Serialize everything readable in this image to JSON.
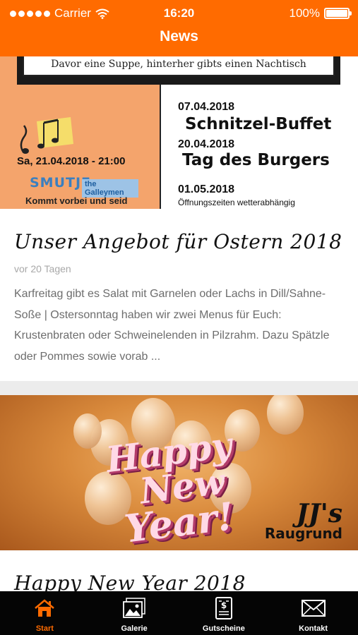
{
  "status_bar": {
    "carrier": "Carrier",
    "time": "16:20",
    "battery": "100%"
  },
  "nav": {
    "title": "News"
  },
  "posts": [
    {
      "image": {
        "banner": "Davor eine Suppe, hinterher gibts einen Nachtisch",
        "event_date": "Sa, 21.04.2018 - 21:00",
        "band": "SMUTJE",
        "band_sub": "the Galleymen",
        "band_tagline": "Kommt vorbei und seid",
        "events": [
          {
            "date": "07.04.2018",
            "name": "Schnitzel-Buffet"
          },
          {
            "date": "20.04.2018",
            "name": "Tag des Burgers"
          },
          {
            "date": "01.05.2018",
            "name": "Öffnungszeiten wetterabhängig"
          }
        ]
      },
      "title": "Unser Angebot für Ostern 2018",
      "age": "vor 20 Tagen",
      "excerpt": "Karfreitag gibt es Salat mit Garnelen oder Lachs in Dill/Sahne-Soße | Ostersonntag haben wir zwei Menus für Euch: Krustenbraten oder Schweinelenden in Pilzrahm. Dazu Spätzle oder Pommes sowie vorab ..."
    },
    {
      "image": {
        "line1": "Happy",
        "line2": "New",
        "line3": "Year!",
        "brand1": "JJ's",
        "brand2": "Raugrund"
      },
      "title": "Happy New Year 2018"
    }
  ],
  "tabs": [
    {
      "label": "Start",
      "icon": "home-icon",
      "active": true
    },
    {
      "label": "Galerie",
      "icon": "gallery-icon",
      "active": false
    },
    {
      "label": "Gutscheine",
      "icon": "voucher-icon",
      "active": false
    },
    {
      "label": "Kontakt",
      "icon": "mail-icon",
      "active": false
    }
  ],
  "colors": {
    "accent": "#ff6b00",
    "tabbar": "#050505",
    "background": "#ececec"
  }
}
